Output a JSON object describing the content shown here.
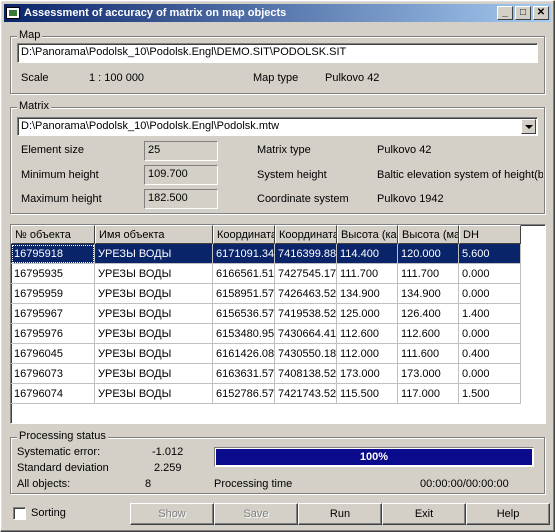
{
  "window": {
    "title": "Assessment of accuracy of matrix on map objects",
    "minimize": "_",
    "maximize": "□",
    "close": "✕"
  },
  "map": {
    "group_label": "Map",
    "path": "D:\\Panorama\\Podolsk_10\\Podolsk.Engl\\DEMO.SIT\\PODOLSK.SIT",
    "scale_label": "Scale",
    "scale_value": "1 : 100 000",
    "maptype_label": "Map type",
    "maptype_value": "Pulkovo 42"
  },
  "matrix": {
    "group_label": "Matrix",
    "path": "D:\\Panorama\\Podolsk_10\\Podolsk.Engl\\Podolsk.mtw",
    "element_size_label": "Element size",
    "element_size_value": "25",
    "min_height_label": "Minimum height",
    "min_height_value": "109.700",
    "max_height_label": "Maximum height",
    "max_height_value": "182.500",
    "matrix_type_label": "Matrix type",
    "matrix_type_value": "Pulkovo 42",
    "system_height_label": "System height",
    "system_height_value": "Baltic elevation system of height(ba",
    "coord_system_label": "Coordinate system",
    "coord_system_value": "Pulkovo 1942"
  },
  "table": {
    "columns": [
      "№ объекта",
      "Имя объекта",
      "Координата",
      "Координата",
      "Высота (ка",
      "Высота (ма",
      "DH"
    ],
    "rows": [
      [
        "16795918",
        "УРЕЗЫ ВОДЫ",
        "6171091.34",
        "7416399.88",
        "114.400",
        "120.000",
        "5.600"
      ],
      [
        "16795935",
        "УРЕЗЫ ВОДЫ",
        "6166561.51",
        "7427545.17",
        "111.700",
        "111.700",
        "0.000"
      ],
      [
        "16795959",
        "УРЕЗЫ ВОДЫ",
        "6158951.57",
        "7426463.52",
        "134.900",
        "134.900",
        "0.000"
      ],
      [
        "16795967",
        "УРЕЗЫ ВОДЫ",
        "6156536.57",
        "7419538.52",
        "125.000",
        "126.400",
        "1.400"
      ],
      [
        "16795976",
        "УРЕЗЫ ВОДЫ",
        "6153480.95",
        "7430664.41",
        "112.600",
        "112.600",
        "0.000"
      ],
      [
        "16796045",
        "УРЕЗЫ ВОДЫ",
        "6161426.08",
        "7430550.18",
        "112.000",
        "111.600",
        "0.400"
      ],
      [
        "16796073",
        "УРЕЗЫ ВОДЫ",
        "6163631.57",
        "7408138.52",
        "173.000",
        "173.000",
        "0.000"
      ],
      [
        "16796074",
        "УРЕЗЫ ВОДЫ",
        "6152786.57",
        "7421743.52",
        "115.500",
        "117.000",
        "1.500"
      ]
    ],
    "selected_row": 0
  },
  "status": {
    "group_label": "Processing status",
    "systematic_error_label": "Systematic error:",
    "systematic_error_value": "-1.012",
    "std_dev_label": "Standard deviation",
    "std_dev_value": "2.259",
    "all_objects_label": "All objects:",
    "all_objects_value": "8",
    "progress_percent": 100,
    "progress_text": "100%",
    "processing_time_label": "Processing time",
    "processing_time_value": "00:00:00/00:00:00"
  },
  "footer": {
    "sorting_label": "Sorting",
    "show_label": "Show",
    "save_label": "Save",
    "run_label": "Run",
    "exit_label": "Exit",
    "help_label": "Help"
  },
  "colors": {
    "title_start": "#0a246a",
    "title_end": "#a6caf0",
    "selection": "#0a246a",
    "progress_fill": "#0a0a8c",
    "face": "#d4d0c8"
  }
}
